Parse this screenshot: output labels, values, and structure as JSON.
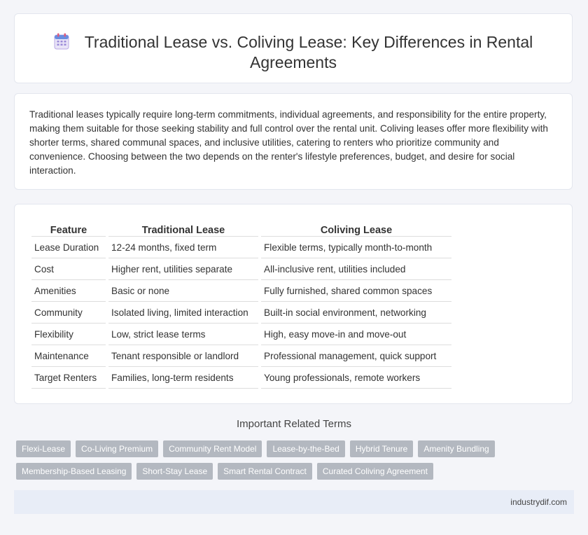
{
  "header": {
    "icon": "calendar-icon",
    "title_line1": "Traditional Lease vs. Coliving Lease: Key Differences in Rental",
    "title_line2": "Agreements"
  },
  "intro": {
    "text": "Traditional leases typically require long-term commitments, individual agreements, and responsibility for the entire property, making them suitable for those seeking stability and full control over the rental unit. Coliving leases offer more flexibility with shorter terms, shared communal spaces, and inclusive utilities, catering to renters who prioritize community and convenience. Choosing between the two depends on the renter's lifestyle preferences, budget, and desire for social interaction."
  },
  "table": {
    "headers": [
      "Feature",
      "Traditional Lease",
      "Coliving Lease"
    ],
    "rows": [
      [
        "Lease Duration",
        "12-24 months, fixed term",
        "Flexible terms, typically month-to-month"
      ],
      [
        "Cost",
        "Higher rent, utilities separate",
        "All-inclusive rent, utilities included"
      ],
      [
        "Amenities",
        "Basic or none",
        "Fully furnished, shared common spaces"
      ],
      [
        "Community",
        "Isolated living, limited interaction",
        "Built-in social environment, networking"
      ],
      [
        "Flexibility",
        "Low, strict lease terms",
        "High, easy move-in and move-out"
      ],
      [
        "Maintenance",
        "Tenant responsible or landlord",
        "Professional management, quick support"
      ],
      [
        "Target Renters",
        "Families, long-term residents",
        "Young professionals, remote workers"
      ]
    ]
  },
  "related": {
    "title": "Important Related Terms",
    "tags": [
      "Flexi-Lease",
      "Co-Living Premium",
      "Community Rent Model",
      "Lease-by-the-Bed",
      "Hybrid Tenure",
      "Amenity Bundling",
      "Membership-Based Leasing",
      "Short-Stay Lease",
      "Smart Rental Contract",
      "Curated Coliving Agreement"
    ]
  },
  "footer": {
    "text": "industrydif.com"
  },
  "colors": {
    "tag_bg": "#b3b8c0",
    "footer_bg": "#e8edf7",
    "page_bg": "#f4f5f9"
  }
}
